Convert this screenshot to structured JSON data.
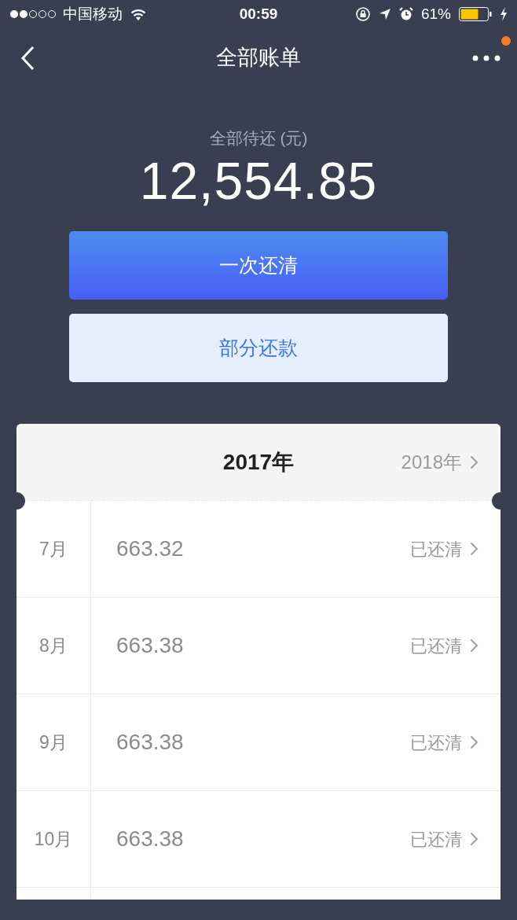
{
  "status_bar": {
    "carrier": "中国移动",
    "time": "00:59",
    "battery": "61%"
  },
  "nav": {
    "title": "全部账单"
  },
  "summary": {
    "label": "全部待还 (元)",
    "amount": "12,554.85"
  },
  "buttons": [
    {
      "label": "一次还清",
      "kind": "primary"
    },
    {
      "label": "部分还款",
      "kind": "secondary"
    }
  ],
  "year_header": {
    "current": "2017年",
    "next": "2018年"
  },
  "bills": [
    {
      "month": "7月",
      "amount": "663.32",
      "status": "已还清"
    },
    {
      "month": "8月",
      "amount": "663.38",
      "status": "已还清"
    },
    {
      "month": "9月",
      "amount": "663.38",
      "status": "已还清"
    },
    {
      "month": "10月",
      "amount": "663.38",
      "status": "已还清"
    }
  ]
}
